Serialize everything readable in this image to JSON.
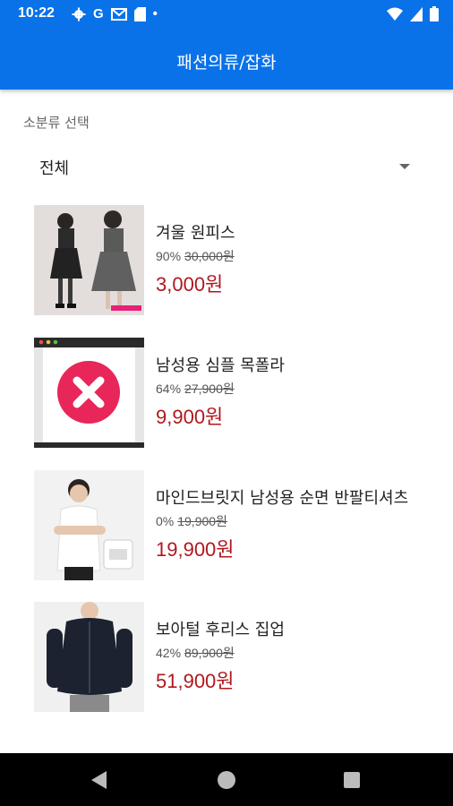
{
  "status": {
    "time": "10:22",
    "icons": [
      "settings-icon",
      "google-icon",
      "gmail-icon",
      "sd-card-icon",
      "dot-icon",
      "wifi-icon",
      "signal-icon",
      "battery-icon"
    ],
    "g_letter": "G",
    "dot": "•"
  },
  "appbar": {
    "title": "패션의류/잡화"
  },
  "filter": {
    "label": "소분류 선택",
    "selected": "전체"
  },
  "products": [
    {
      "name": "겨울 원피스",
      "discount": "90%",
      "original_price": "30,000원",
      "price": "3,000원",
      "image": "two-women-in-dresses-photo"
    },
    {
      "name": "남성용 심플 목폴라",
      "discount": "64%",
      "original_price": "27,900원",
      "price": "9,900원",
      "image": "broken-image-placeholder"
    },
    {
      "name": "마인드브릿지 남성용 순면 반팔티셔츠",
      "discount": "0%",
      "original_price": "19,900원",
      "price": "19,900원",
      "image": "man-in-white-tshirt-photo"
    },
    {
      "name": "보아털 후리스 집업",
      "discount": "42%",
      "original_price": "89,900원",
      "price": "51,900원",
      "image": "navy-fleece-jacket-photo"
    }
  ],
  "colors": {
    "primary": "#0a72e8",
    "price": "#b0181f",
    "placeholder_icon": "#e8265a"
  }
}
